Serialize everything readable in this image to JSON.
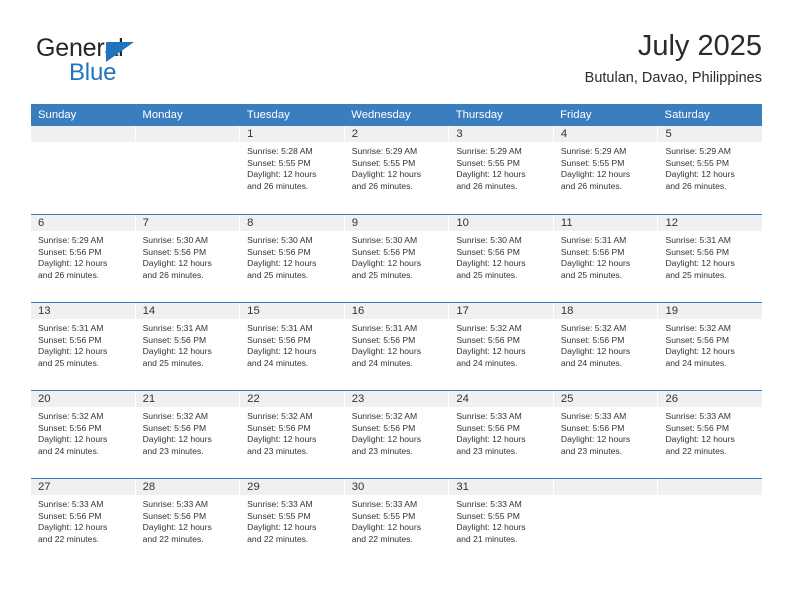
{
  "brand": {
    "name_part1": "General",
    "name_part2": "Blue",
    "triangle_icon": "brand-triangle-icon",
    "accent_color": "#1f74bd"
  },
  "header": {
    "title": "July 2025",
    "location": "Butulan, Davao, Philippines",
    "header_bg_color": "#3a7ebf",
    "daynum_bg_color": "#f0f0f0"
  },
  "calendar": {
    "weekday_headers": [
      "Sunday",
      "Monday",
      "Tuesday",
      "Wednesday",
      "Thursday",
      "Friday",
      "Saturday"
    ],
    "weeks": [
      [
        {
          "day": "",
          "sunrise": "",
          "sunset": "",
          "daylight1": "",
          "daylight2": ""
        },
        {
          "day": "",
          "sunrise": "",
          "sunset": "",
          "daylight1": "",
          "daylight2": ""
        },
        {
          "day": "1",
          "sunrise": "Sunrise: 5:28 AM",
          "sunset": "Sunset: 5:55 PM",
          "daylight1": "Daylight: 12 hours",
          "daylight2": "and 26 minutes."
        },
        {
          "day": "2",
          "sunrise": "Sunrise: 5:29 AM",
          "sunset": "Sunset: 5:55 PM",
          "daylight1": "Daylight: 12 hours",
          "daylight2": "and 26 minutes."
        },
        {
          "day": "3",
          "sunrise": "Sunrise: 5:29 AM",
          "sunset": "Sunset: 5:55 PM",
          "daylight1": "Daylight: 12 hours",
          "daylight2": "and 26 minutes."
        },
        {
          "day": "4",
          "sunrise": "Sunrise: 5:29 AM",
          "sunset": "Sunset: 5:55 PM",
          "daylight1": "Daylight: 12 hours",
          "daylight2": "and 26 minutes."
        },
        {
          "day": "5",
          "sunrise": "Sunrise: 5:29 AM",
          "sunset": "Sunset: 5:55 PM",
          "daylight1": "Daylight: 12 hours",
          "daylight2": "and 26 minutes."
        }
      ],
      [
        {
          "day": "6",
          "sunrise": "Sunrise: 5:29 AM",
          "sunset": "Sunset: 5:56 PM",
          "daylight1": "Daylight: 12 hours",
          "daylight2": "and 26 minutes."
        },
        {
          "day": "7",
          "sunrise": "Sunrise: 5:30 AM",
          "sunset": "Sunset: 5:56 PM",
          "daylight1": "Daylight: 12 hours",
          "daylight2": "and 26 minutes."
        },
        {
          "day": "8",
          "sunrise": "Sunrise: 5:30 AM",
          "sunset": "Sunset: 5:56 PM",
          "daylight1": "Daylight: 12 hours",
          "daylight2": "and 25 minutes."
        },
        {
          "day": "9",
          "sunrise": "Sunrise: 5:30 AM",
          "sunset": "Sunset: 5:56 PM",
          "daylight1": "Daylight: 12 hours",
          "daylight2": "and 25 minutes."
        },
        {
          "day": "10",
          "sunrise": "Sunrise: 5:30 AM",
          "sunset": "Sunset: 5:56 PM",
          "daylight1": "Daylight: 12 hours",
          "daylight2": "and 25 minutes."
        },
        {
          "day": "11",
          "sunrise": "Sunrise: 5:31 AM",
          "sunset": "Sunset: 5:56 PM",
          "daylight1": "Daylight: 12 hours",
          "daylight2": "and 25 minutes."
        },
        {
          "day": "12",
          "sunrise": "Sunrise: 5:31 AM",
          "sunset": "Sunset: 5:56 PM",
          "daylight1": "Daylight: 12 hours",
          "daylight2": "and 25 minutes."
        }
      ],
      [
        {
          "day": "13",
          "sunrise": "Sunrise: 5:31 AM",
          "sunset": "Sunset: 5:56 PM",
          "daylight1": "Daylight: 12 hours",
          "daylight2": "and 25 minutes."
        },
        {
          "day": "14",
          "sunrise": "Sunrise: 5:31 AM",
          "sunset": "Sunset: 5:56 PM",
          "daylight1": "Daylight: 12 hours",
          "daylight2": "and 25 minutes."
        },
        {
          "day": "15",
          "sunrise": "Sunrise: 5:31 AM",
          "sunset": "Sunset: 5:56 PM",
          "daylight1": "Daylight: 12 hours",
          "daylight2": "and 24 minutes."
        },
        {
          "day": "16",
          "sunrise": "Sunrise: 5:31 AM",
          "sunset": "Sunset: 5:56 PM",
          "daylight1": "Daylight: 12 hours",
          "daylight2": "and 24 minutes."
        },
        {
          "day": "17",
          "sunrise": "Sunrise: 5:32 AM",
          "sunset": "Sunset: 5:56 PM",
          "daylight1": "Daylight: 12 hours",
          "daylight2": "and 24 minutes."
        },
        {
          "day": "18",
          "sunrise": "Sunrise: 5:32 AM",
          "sunset": "Sunset: 5:56 PM",
          "daylight1": "Daylight: 12 hours",
          "daylight2": "and 24 minutes."
        },
        {
          "day": "19",
          "sunrise": "Sunrise: 5:32 AM",
          "sunset": "Sunset: 5:56 PM",
          "daylight1": "Daylight: 12 hours",
          "daylight2": "and 24 minutes."
        }
      ],
      [
        {
          "day": "20",
          "sunrise": "Sunrise: 5:32 AM",
          "sunset": "Sunset: 5:56 PM",
          "daylight1": "Daylight: 12 hours",
          "daylight2": "and 24 minutes."
        },
        {
          "day": "21",
          "sunrise": "Sunrise: 5:32 AM",
          "sunset": "Sunset: 5:56 PM",
          "daylight1": "Daylight: 12 hours",
          "daylight2": "and 23 minutes."
        },
        {
          "day": "22",
          "sunrise": "Sunrise: 5:32 AM",
          "sunset": "Sunset: 5:56 PM",
          "daylight1": "Daylight: 12 hours",
          "daylight2": "and 23 minutes."
        },
        {
          "day": "23",
          "sunrise": "Sunrise: 5:32 AM",
          "sunset": "Sunset: 5:56 PM",
          "daylight1": "Daylight: 12 hours",
          "daylight2": "and 23 minutes."
        },
        {
          "day": "24",
          "sunrise": "Sunrise: 5:33 AM",
          "sunset": "Sunset: 5:56 PM",
          "daylight1": "Daylight: 12 hours",
          "daylight2": "and 23 minutes."
        },
        {
          "day": "25",
          "sunrise": "Sunrise: 5:33 AM",
          "sunset": "Sunset: 5:56 PM",
          "daylight1": "Daylight: 12 hours",
          "daylight2": "and 23 minutes."
        },
        {
          "day": "26",
          "sunrise": "Sunrise: 5:33 AM",
          "sunset": "Sunset: 5:56 PM",
          "daylight1": "Daylight: 12 hours",
          "daylight2": "and 22 minutes."
        }
      ],
      [
        {
          "day": "27",
          "sunrise": "Sunrise: 5:33 AM",
          "sunset": "Sunset: 5:56 PM",
          "daylight1": "Daylight: 12 hours",
          "daylight2": "and 22 minutes."
        },
        {
          "day": "28",
          "sunrise": "Sunrise: 5:33 AM",
          "sunset": "Sunset: 5:56 PM",
          "daylight1": "Daylight: 12 hours",
          "daylight2": "and 22 minutes."
        },
        {
          "day": "29",
          "sunrise": "Sunrise: 5:33 AM",
          "sunset": "Sunset: 5:55 PM",
          "daylight1": "Daylight: 12 hours",
          "daylight2": "and 22 minutes."
        },
        {
          "day": "30",
          "sunrise": "Sunrise: 5:33 AM",
          "sunset": "Sunset: 5:55 PM",
          "daylight1": "Daylight: 12 hours",
          "daylight2": "and 22 minutes."
        },
        {
          "day": "31",
          "sunrise": "Sunrise: 5:33 AM",
          "sunset": "Sunset: 5:55 PM",
          "daylight1": "Daylight: 12 hours",
          "daylight2": "and 21 minutes."
        },
        {
          "day": "",
          "sunrise": "",
          "sunset": "",
          "daylight1": "",
          "daylight2": ""
        },
        {
          "day": "",
          "sunrise": "",
          "sunset": "",
          "daylight1": "",
          "daylight2": ""
        }
      ]
    ]
  }
}
